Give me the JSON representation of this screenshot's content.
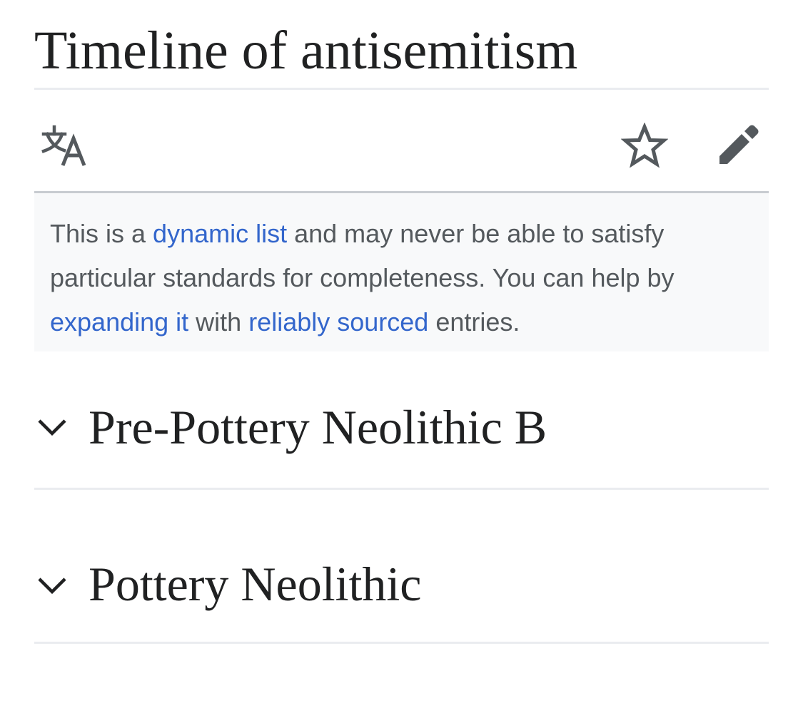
{
  "page": {
    "title": "Timeline of antisemitism"
  },
  "actions": {
    "language_icon": "translate-icon",
    "watch_icon": "star-icon",
    "edit_icon": "pencil-icon"
  },
  "notice": {
    "text_1": "This is a ",
    "link_1": "dynamic list",
    "text_2": " and may never be able to satisfy particular standards for completeness. You can help by ",
    "link_2": "expanding it",
    "text_3": " with ",
    "link_3": "reliably sourced",
    "text_4": " entries."
  },
  "sections": [
    {
      "title": "Pre-Pottery Neolithic B",
      "icon": "chevron-down-icon"
    },
    {
      "title": "Pottery Neolithic",
      "icon": "chevron-down-icon"
    }
  ],
  "colors": {
    "text": "#202122",
    "muted_text": "#54595d",
    "link": "#3366cc",
    "icon": "#54595d",
    "notice_bg": "#f8f9fa",
    "divider": "#eaecf0"
  }
}
